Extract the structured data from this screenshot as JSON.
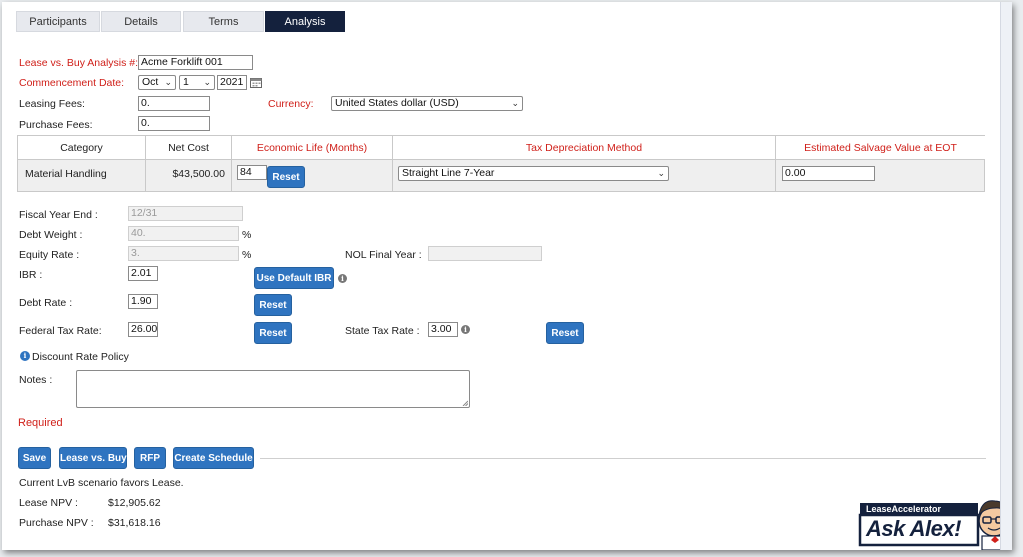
{
  "tabs": [
    {
      "label": "Participants"
    },
    {
      "label": "Details"
    },
    {
      "label": "Terms"
    },
    {
      "label": "Analysis"
    }
  ],
  "form": {
    "lvb_label": "Lease vs. Buy Analysis #:",
    "lvb_value": "Acme Forklift 001",
    "commencement_label": "Commencement Date:",
    "month": "Oct",
    "day": "1",
    "year": "2021",
    "leasing_fees_label": "Leasing Fees:",
    "leasing_fees_value": "0.",
    "currency_label": "Currency:",
    "currency_value": "United States dollar (USD)",
    "purchase_fees_label": "Purchase Fees:",
    "purchase_fees_value": "0."
  },
  "table": {
    "headers": {
      "category": "Category",
      "net_cost": "Net Cost",
      "economic_life": "Economic Life (Months)",
      "tax_method": "Tax Depreciation Method",
      "salvage": "Estimated Salvage Value at EOT"
    },
    "row": {
      "category": "Material Handling",
      "net_cost": "$43,500.00",
      "economic_life": "84",
      "reset_label": "Reset",
      "tax_method": "Straight Line 7-Year",
      "salvage": "0.00"
    }
  },
  "rates": {
    "fiscal_year_end_label": "Fiscal Year End :",
    "fiscal_year_end_value": "12/31",
    "debt_weight_label": "Debt Weight :",
    "debt_weight_value": "40.",
    "equity_rate_label": "Equity Rate :",
    "equity_rate_value": "3.",
    "percent": "%",
    "nol_label": "NOL Final Year :",
    "nol_value": "",
    "ibr_label": "IBR :",
    "ibr_value": "2.01",
    "use_default_ibr": "Use Default IBR",
    "debt_rate_label": "Debt Rate :",
    "debt_rate_value": "1.90",
    "reset_label": "Reset",
    "federal_tax_label": "Federal Tax Rate:",
    "federal_tax_value": "26.00",
    "state_tax_label": "State Tax Rate :",
    "state_tax_value": "3.00",
    "discount_policy": "Discount Rate Policy",
    "notes_label": "Notes :",
    "required": "Required"
  },
  "actions": {
    "save": "Save",
    "lease_vs_buy": "Lease vs. Buy",
    "rfp": "RFP",
    "create_schedule": "Create Schedule"
  },
  "results": {
    "scenario": "Current LvB scenario favors Lease.",
    "lease_npv_label": "Lease NPV :",
    "lease_npv_value": "$12,905.62",
    "purchase_npv_label": "Purchase NPV :",
    "purchase_npv_value": "$31,618.16"
  },
  "badge": {
    "brand": "LeaseAccelerator",
    "text": "Ask Alex!"
  },
  "icons": [
    "calendar-icon",
    "chevron-down-icon",
    "info-icon",
    "mascot-avatar"
  ],
  "colors": {
    "accent": "#2f74c0",
    "active_tab": "#14213d",
    "required": "#d0201a"
  }
}
